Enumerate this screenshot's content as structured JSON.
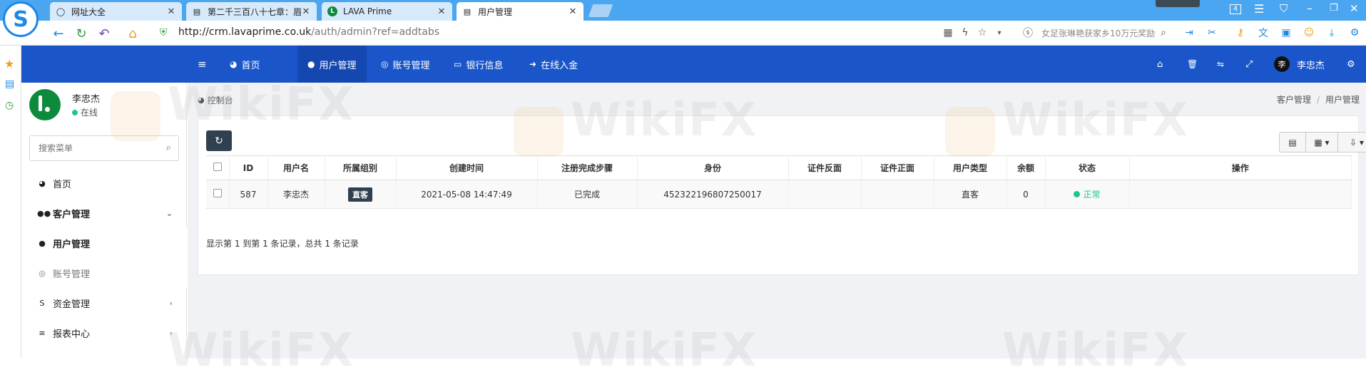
{
  "browser": {
    "tabs": [
      {
        "title": "网址大全",
        "icon": "globe-icon",
        "active": false
      },
      {
        "title": "第二千三百八十七章：眉",
        "icon": "page-icon",
        "active": false
      },
      {
        "title": "LAVA Prime",
        "icon": "lava-icon",
        "active": false
      },
      {
        "title": "用户管理",
        "icon": "page-icon",
        "active": true
      }
    ],
    "url_host": "http://crm.lavaprime.co.uk",
    "url_path": "/auth/admin?ref=addtabs",
    "search_hint": "女足张琳艳获家乡10万元奖励",
    "badge_count": "4"
  },
  "appbar": {
    "nav": [
      {
        "label": "首页",
        "icon": "dashboard-icon"
      },
      {
        "label": "用户管理",
        "icon": "user-icon",
        "active": true
      },
      {
        "label": "账号管理",
        "icon": "account-icon"
      },
      {
        "label": "银行信息",
        "icon": "card-icon"
      },
      {
        "label": "在线入金",
        "icon": "deposit-icon"
      }
    ],
    "user_name": "李忠杰",
    "user_avatar_char": "李"
  },
  "sidebar": {
    "user_name": "李忠杰",
    "user_status": "在线",
    "search_placeholder": "搜索菜单",
    "items": [
      {
        "label": "首页",
        "icon": "dashboard-icon"
      },
      {
        "label": "客户管理",
        "icon": "users-icon",
        "arrow": "⌄"
      },
      {
        "label": "用户管理",
        "icon": "user-icon"
      },
      {
        "label": "账号管理",
        "icon": "account-icon"
      },
      {
        "label": "资金管理",
        "icon": "money-icon",
        "arrow": "‹"
      },
      {
        "label": "报表中心",
        "icon": "report-icon",
        "arrow": "‹"
      }
    ]
  },
  "content": {
    "crumb_left": "控制台",
    "crumb_right": [
      "客户管理",
      "用户管理"
    ],
    "table": {
      "headers": [
        "ID",
        "用户名",
        "所属组别",
        "创建时间",
        "注册完成步骤",
        "身份",
        "证件反面",
        "证件正面",
        "用户类型",
        "余额",
        "状态",
        "操作"
      ],
      "rows": [
        {
          "id": "587",
          "username": "李忠杰",
          "group": "直客",
          "created": "2021-05-08 14:47:49",
          "step": "已完成",
          "identity": "452322196807250017",
          "id_back": "",
          "id_front": "",
          "user_type": "直客",
          "balance": "0",
          "status": "正常",
          "action": ""
        }
      ]
    },
    "pager_info": "显示第 1 到第 1 条记录，总共 1 条记录"
  },
  "watermark": "WikiFX",
  "colors": {
    "tabbar": "#4aa6f0",
    "appbar": "#1a56c9",
    "dark_button": "#2f4050",
    "status_green": "#1bc98e"
  }
}
